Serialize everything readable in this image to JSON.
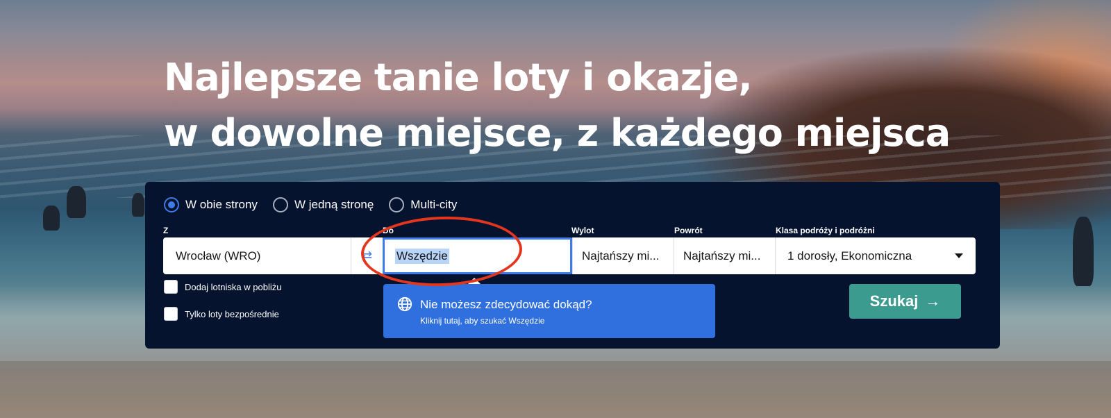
{
  "hero": {
    "line1": "Najlepsze tanie loty i okazje,",
    "line2": "w dowolne miejsce, z każdego miejsca"
  },
  "search": {
    "trip_types": [
      {
        "label": "W obie strony",
        "checked": true
      },
      {
        "label": "W jedną stronę",
        "checked": false
      },
      {
        "label": "Multi-city",
        "checked": false
      }
    ],
    "labels": {
      "from": "Z",
      "to": "Do",
      "depart": "Wylot",
      "return": "Powrót",
      "class": "Klasa podróży i podróżni"
    },
    "values": {
      "from": "Wrocław (WRO)",
      "to": "Wszędzie",
      "depart": "Najtańszy mi...",
      "return": "Najtańszy mi...",
      "class": "1 dorosły, Ekonomiczna"
    },
    "checkboxes": {
      "nearby": "Dodaj lotniska w pobliżu",
      "direct": "Tylko loty bezpośrednie"
    },
    "submit_label": "Szukaj"
  },
  "popup": {
    "title": "Nie możesz zdecydować dokąd?",
    "subtitle": "Kliknij tutaj, aby szukać Wszędzie"
  },
  "colors": {
    "panel_bg": "#05132e",
    "accent_blue": "#3f7be8",
    "popup_blue": "#2f6fde",
    "search_green": "#3b9b8f",
    "annotation_red": "#e2361f"
  }
}
